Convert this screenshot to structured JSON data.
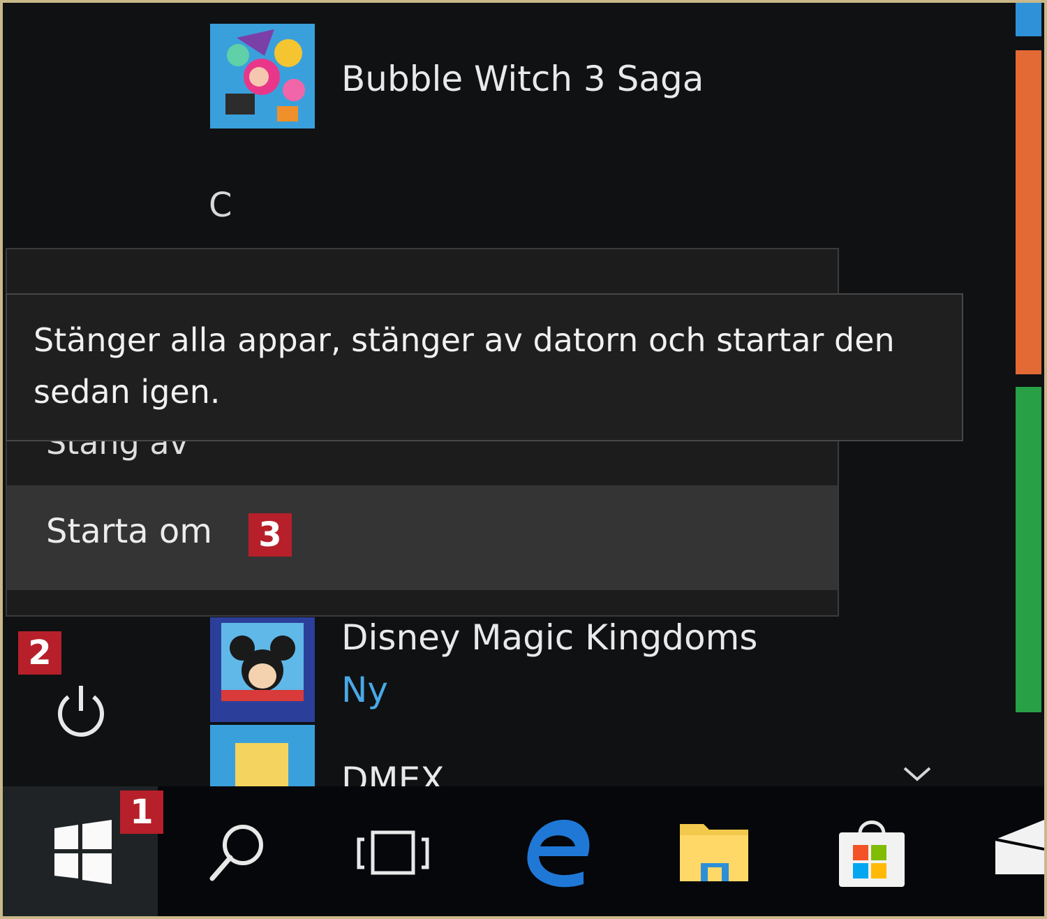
{
  "start_menu": {
    "apps": [
      {
        "name": "Bubble Witch 3 Saga",
        "icon": "bubble-witch-app-icon"
      },
      {
        "group_letter": "C"
      },
      {
        "name": "Disney Magic Kingdoms",
        "badge": "Ny",
        "icon": "disney-app-icon"
      },
      {
        "name": "DMEX",
        "icon": "folder-app-icon"
      }
    ],
    "tile_colors": [
      "#2f92d8",
      "#e46a35",
      "#27a046"
    ]
  },
  "power_menu": {
    "partial_item": "Stäng av",
    "restart_label": "Starta om",
    "tooltip": "Stänger alla appar, stänger av datorn och startar den sedan igen."
  },
  "callouts": {
    "taskbar_start": "1",
    "power_button": "2",
    "restart_item": "3"
  },
  "taskbar": {
    "icons": [
      "windows-start-icon",
      "search-icon",
      "task-view-icon",
      "edge-icon",
      "file-explorer-icon",
      "store-icon",
      "mail-icon"
    ]
  },
  "colors": {
    "callout_red": "#b7202a",
    "accent_blue": "#4aa8e6"
  }
}
